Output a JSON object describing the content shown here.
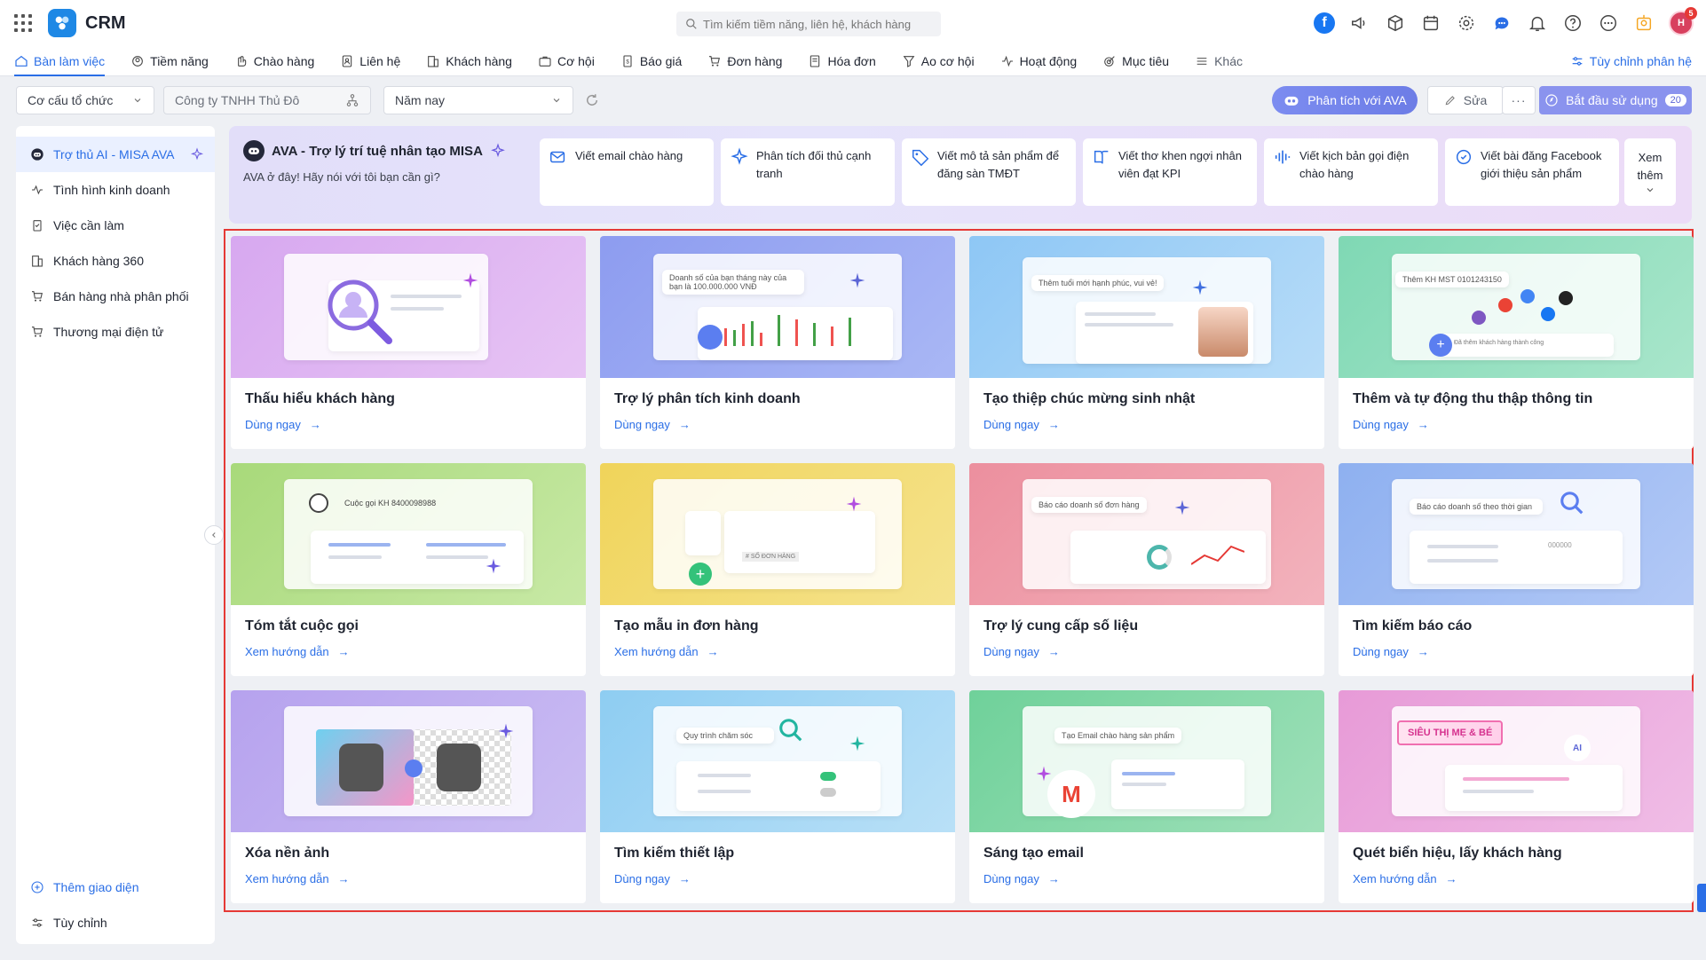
{
  "app": {
    "title": "CRM",
    "avatar_initials": "H",
    "notification_count": "5"
  },
  "search": {
    "placeholder": "Tìm kiếm tiềm năng, liên hệ, khách hàng"
  },
  "nav": {
    "items": [
      {
        "label": "Bàn làm việc",
        "icon": "desk-icon"
      },
      {
        "label": "Tiềm năng",
        "icon": "target-icon"
      },
      {
        "label": "Chào hàng",
        "icon": "hand-icon"
      },
      {
        "label": "Liên hệ",
        "icon": "contact-icon"
      },
      {
        "label": "Khách hàng",
        "icon": "building-icon"
      },
      {
        "label": "Cơ hội",
        "icon": "briefcase-icon"
      },
      {
        "label": "Báo giá",
        "icon": "quote-icon"
      },
      {
        "label": "Đơn hàng",
        "icon": "cart-icon"
      },
      {
        "label": "Hóa đơn",
        "icon": "invoice-icon"
      },
      {
        "label": "Ao cơ hội",
        "icon": "funnel-icon"
      },
      {
        "label": "Hoạt động",
        "icon": "activity-icon"
      },
      {
        "label": "Mục tiêu",
        "icon": "goal-icon"
      },
      {
        "label": "Khác",
        "icon": "menu-icon"
      }
    ],
    "customize_label": "Tùy chỉnh phân hệ"
  },
  "filters": {
    "org_structure": "Cơ cấu tổ chức",
    "company": "Công ty TNHH Thủ Đô",
    "period": "Năm nay"
  },
  "actions": {
    "ava_label": "Phân tích với AVA",
    "edit_label": "Sửa",
    "more_label": "···",
    "start_label": "Bắt đầu sử dụng",
    "start_count": "20"
  },
  "sidebar": {
    "items": [
      {
        "label": "Trợ thủ AI - MISA AVA"
      },
      {
        "label": "Tình hình kinh doanh"
      },
      {
        "label": "Việc cần làm"
      },
      {
        "label": "Khách hàng 360"
      },
      {
        "label": "Bán hàng nhà phân phối"
      },
      {
        "label": "Thương mại điện tử"
      }
    ],
    "add_label": "Thêm giao diện",
    "customize_label": "Tùy chỉnh"
  },
  "ava": {
    "title": "AVA - Trợ lý trí tuệ nhân tạo MISA",
    "subtitle": "AVA ở đây! Hãy nói với tôi bạn cần gì?",
    "prompts": [
      {
        "label": "Viết email chào hàng"
      },
      {
        "label": "Phân tích đối thủ cạnh tranh"
      },
      {
        "label": "Viết mô tả sản phẩm để đăng sàn TMĐT"
      },
      {
        "label": "Viết thơ khen ngợi nhân viên đạt KPI"
      },
      {
        "label": "Viết kịch bản gọi điện chào hàng"
      },
      {
        "label": "Viết bài đăng Facebook giới thiệu sản phẩm"
      }
    ],
    "more_label": "Xem thêm"
  },
  "features": [
    {
      "title": "Thấu hiểu khách hàng",
      "link": "Dùng ngay"
    },
    {
      "title": "Trợ lý phân tích kinh doanh",
      "link": "Dùng ngay",
      "thumb_text": "Doanh số của bạn tháng này của bạn là 100.000.000 VNĐ"
    },
    {
      "title": "Tạo thiệp chúc mừng sinh nhật",
      "link": "Dùng ngay",
      "thumb_text": "Thêm tuổi mới hạnh phúc, vui vẻ!"
    },
    {
      "title": "Thêm và tự động thu thập thông tin",
      "link": "Dùng ngay",
      "thumb_text": "Thêm KH MST 0101243150",
      "thumb_text2": "Đã thêm khách hàng thành công"
    },
    {
      "title": "Tóm tắt cuộc gọi",
      "link": "Xem hướng dẫn",
      "thumb_text": "Cuộc gọi KH 8400098988"
    },
    {
      "title": "Tạo mẫu in đơn hàng",
      "link": "Xem hướng dẫn",
      "thumb_text": "# SỐ ĐƠN HÀNG"
    },
    {
      "title": "Trợ lý cung cấp số liệu",
      "link": "Dùng ngay",
      "thumb_text": "Báo cáo doanh số đơn hàng"
    },
    {
      "title": "Tìm kiếm báo cáo",
      "link": "Dùng ngay",
      "thumb_text": "Báo cáo doanh số theo thời gian",
      "thumb_text2": "000000"
    },
    {
      "title": "Xóa nền ảnh",
      "link": "Xem hướng dẫn"
    },
    {
      "title": "Tìm kiếm thiết lập",
      "link": "Dùng ngay",
      "thumb_text": "Quy trình chăm sóc"
    },
    {
      "title": "Sáng tạo email",
      "link": "Dùng ngay",
      "thumb_text": "Tạo Email chào hàng sản phẩm"
    },
    {
      "title": "Quét biển hiệu, lấy khách hàng",
      "link": "Xem hướng dẫn",
      "thumb_text": "SIÊU THỊ MẸ & BÉ",
      "thumb_text2": "AI"
    }
  ],
  "colors": {
    "accent": "#2a6ee6",
    "highlight_frame": "#e53935"
  }
}
